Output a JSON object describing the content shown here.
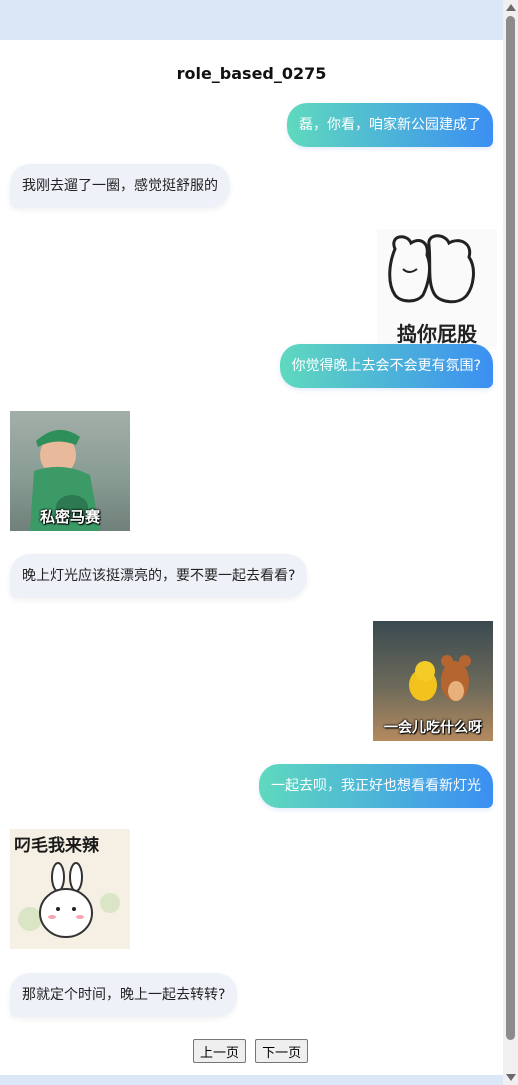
{
  "title": "role_based_0275",
  "messages": [
    {
      "side": "right",
      "text": "磊，你看，咱家新公园建成了"
    },
    {
      "side": "left",
      "text": "我刚去遛了一圈，感觉挺舒服的"
    },
    {
      "side": "right",
      "sticker": "捣你屁股"
    },
    {
      "side": "right",
      "text": "你觉得晚上去会不会更有氛围?"
    },
    {
      "side": "left",
      "sticker": "私密马赛"
    },
    {
      "side": "left",
      "text": "晚上灯光应该挺漂亮的，要不要一起去看看?"
    },
    {
      "side": "right",
      "sticker": "一会儿吃什么呀"
    },
    {
      "side": "right",
      "text": "一起去呗，我正好也想看看新灯光"
    },
    {
      "side": "left",
      "sticker": "叼毛我来辣"
    },
    {
      "side": "left",
      "text": "那就定个时间，晚上一起去转转?"
    }
  ],
  "pager": {
    "prev": "上一页",
    "next": "下一页"
  }
}
